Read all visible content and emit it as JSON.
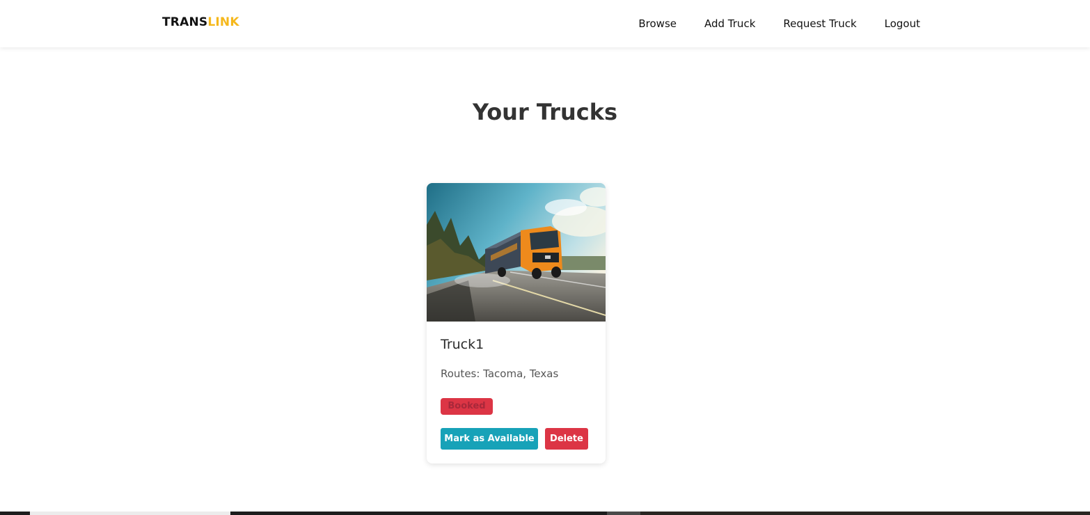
{
  "brand": {
    "part1": "TRANS",
    "part2": "LINK",
    "accent_color": "#f5b81c"
  },
  "nav": {
    "items": [
      {
        "label": "Browse"
      },
      {
        "label": "Add Truck"
      },
      {
        "label": "Request Truck"
      },
      {
        "label": "Logout"
      }
    ]
  },
  "main": {
    "title": "Your Trucks",
    "trucks": [
      {
        "name": "Truck1",
        "routes": "Routes: Tacoma, Texas",
        "status": "Booked",
        "status_color": "#dc3545",
        "image_alt": "orange semi truck on highway",
        "actions": {
          "mark_available": "Mark as Available",
          "delete": "Delete"
        }
      }
    ]
  },
  "colors": {
    "info": "#17a2b8",
    "danger": "#dc3545",
    "title": "#333333"
  }
}
